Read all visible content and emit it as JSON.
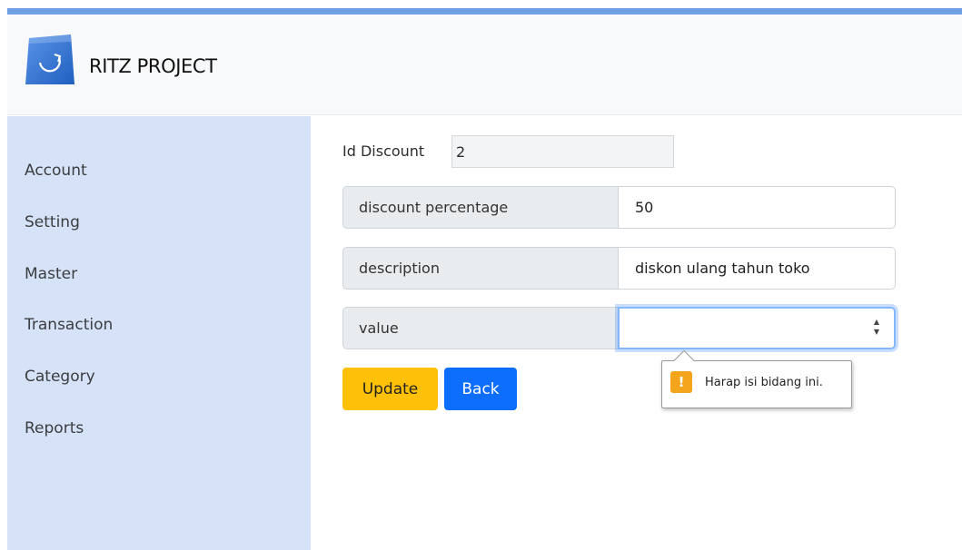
{
  "brand": {
    "name": "RITZ PROJECT",
    "logo_icon": "shopping-bag-icon"
  },
  "colors": {
    "accent_bar": "#6f9fe4",
    "sidebar_bg": "#d6e2f7",
    "update_button": "#ffc107",
    "back_button": "#0d6efd",
    "warning": "#f4a51c"
  },
  "sidebar": {
    "items": [
      {
        "label": "Account"
      },
      {
        "label": "Setting"
      },
      {
        "label": "Master"
      },
      {
        "label": "Transaction"
      },
      {
        "label": "Category"
      },
      {
        "label": "Reports"
      }
    ]
  },
  "form": {
    "id_label": "Id Discount",
    "id_value": "2",
    "fields": [
      {
        "label": "discount percentage",
        "value": "50"
      },
      {
        "label": "description",
        "value": "diskon ulang tahun toko"
      },
      {
        "label": "value",
        "value": ""
      }
    ],
    "update_label": "Update",
    "back_label": "Back"
  },
  "validation": {
    "message": "Harap isi bidang ini.",
    "icon": "warning-icon"
  }
}
